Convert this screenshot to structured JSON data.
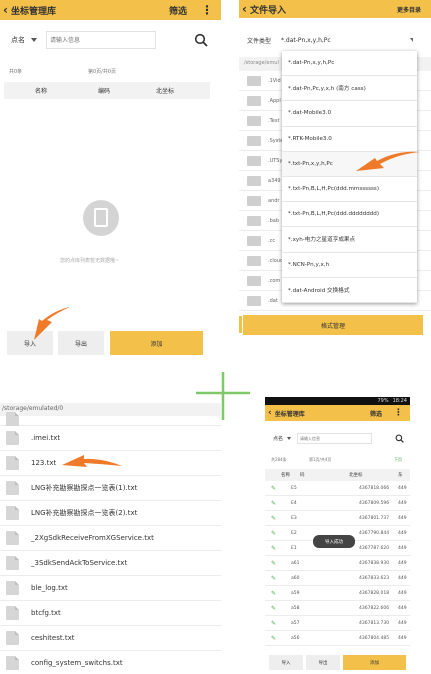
{
  "p1": {
    "back": "‹",
    "title": "坐标管理库",
    "filter": "筛选",
    "more": "⋮",
    "point_label": "点名",
    "search_placeholder": "请输入信息",
    "count_left": "共0条",
    "count_mid": "第0页/共0页",
    "columns": [
      "名称",
      "编码",
      "北坐标"
    ],
    "empty_text": "您的点库列表暂无数据哦~",
    "btn_import": "导入",
    "btn_export": "导出",
    "btn_add": "添加"
  },
  "p2": {
    "back": "‹",
    "title": "文件导入",
    "more_dir": "更多目录",
    "filetype_label": "文件类型",
    "filetype_value": "*.dat-Pn,x,y,h,Pc",
    "path": "/storage/emul",
    "folders": [
      ".1Vid",
      ".Appl",
      ".Test",
      ".Syste",
      ".UTSy",
      "a349",
      "andr",
      ".bab",
      ".cc",
      ".cloud",
      ".com",
      ".dat"
    ],
    "options": [
      "*.dat-Pn,x,y,h,Pc",
      "*.dat-Pn,Pc,y,x,h (南方 cass)",
      "*.dat-Mobile3.0",
      "*.RTK-Mobile3.0",
      "*.txt-Pn,x,y,h,Pc",
      "*.txt-Pn,B,L,H,Pc(ddd.mmssssss)",
      "*.txt-Pn,B,L,H,Pc(ddd.dddddddd)",
      "*.xyh-电力之星道亨成果点",
      "*.NCN-Pn,y,x,h",
      "*.dat-Android 交换格式"
    ],
    "format_btn": "格式管理"
  },
  "p3": {
    "path": "/storage/emulated/0",
    "files": [
      ".imei.txt",
      "123.txt",
      "LNG补充勘察勘探点一览表(1).txt",
      "LNG补充勘察勘探点一览表(2).txt",
      "_2XgSdkReceiveFromXGService.txt",
      "_3SdkSendAckToService.txt",
      "ble_log.txt",
      "btcfg.txt",
      "ceshitest.txt",
      "config_system_switchs.txt"
    ]
  },
  "p4": {
    "status_time": "18:24",
    "status_batt": "79%",
    "back": "‹",
    "title": "坐标管理库",
    "filter": "筛选",
    "point_label": "点名",
    "search_placeholder": "请输入信息",
    "count_left": "共284条",
    "count_mid": "第1页/共4页",
    "next": "下页",
    "columns": [
      "名称",
      "码",
      "北坐标",
      "东"
    ],
    "rows": [
      [
        "E5",
        "4367818.066",
        "449"
      ],
      [
        "E4",
        "4367809.596",
        "449"
      ],
      [
        "E3",
        "4367801.737",
        "449"
      ],
      [
        "E2",
        "4367790.844",
        "449"
      ],
      [
        "E1",
        "4367787.620",
        "449"
      ],
      [
        "a61",
        "4367838.930",
        "449"
      ],
      [
        "a60",
        "4367833.623",
        "449"
      ],
      [
        "a59",
        "4367828.018",
        "449"
      ],
      [
        "a58",
        "4367822.606",
        "449"
      ],
      [
        "a57",
        "4367813.730",
        "449"
      ],
      [
        "a56",
        "4367804.485",
        "449"
      ]
    ],
    "toast": "导入成功",
    "btn_import": "导入",
    "btn_export": "导出",
    "btn_add": "添加"
  },
  "colors": {
    "accent": "#f3c04a",
    "arrow": "#ef7b2a",
    "divider": "#7fc96b",
    "pen": "#4caf50"
  }
}
